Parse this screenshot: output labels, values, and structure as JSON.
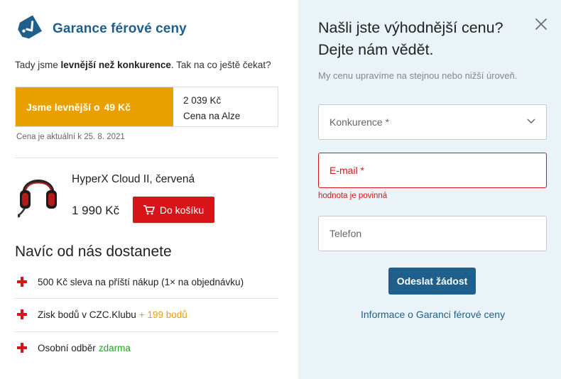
{
  "left": {
    "header_title": "Garance férové ceny",
    "intro_prefix": "Tady jsme ",
    "intro_bold": "levnější než konkurence",
    "intro_suffix": ". Tak na co ještě čekat?",
    "cheaper_label": "Jsme levnější o",
    "cheaper_amount": "49 Kč",
    "rival_price": "2 039 Kč",
    "rival_name": "Cena na Alze",
    "valid_text": "Cena je aktuální k 25. 8. 2021",
    "product_name": "HyperX Cloud II, červená",
    "product_price": "1 990 Kč",
    "cart_button": "Do košíku",
    "extras_title": "Navíc od nás dostanete",
    "extras": [
      {
        "text": "500 Kč sleva na příští nákup (1× na objednávku)",
        "highlight": ""
      },
      {
        "text": "Zisk bodů v CZC.Klubu",
        "highlight": "+ 199 bodů"
      },
      {
        "text": "Osobní odběr",
        "highlight": "zdarma"
      }
    ]
  },
  "right": {
    "title_line1": "Našli jste výhodnější cenu?",
    "title_line2": "Dejte nám vědět.",
    "subtitle": "My cenu upravíme na stejnou nebo nižší úroveň.",
    "competitor_placeholder": "Konkurence *",
    "email_placeholder": "E-mail *",
    "email_error": "hodnota je povinná",
    "phone_placeholder": "Telefon",
    "submit_label": "Odeslat žádost",
    "info_link": "Informace o Garanci férové ceny"
  },
  "colors": {
    "brand_blue": "#1f5f8b",
    "accent_orange": "#e8a000",
    "accent_red": "#d7141a",
    "green": "#2a9d2a",
    "panel_bg": "#eaf3f8"
  },
  "icons": [
    "price-tag-check-icon",
    "headset-product-image",
    "cart-icon",
    "plus-icon",
    "close-icon",
    "chevron-down-icon"
  ]
}
